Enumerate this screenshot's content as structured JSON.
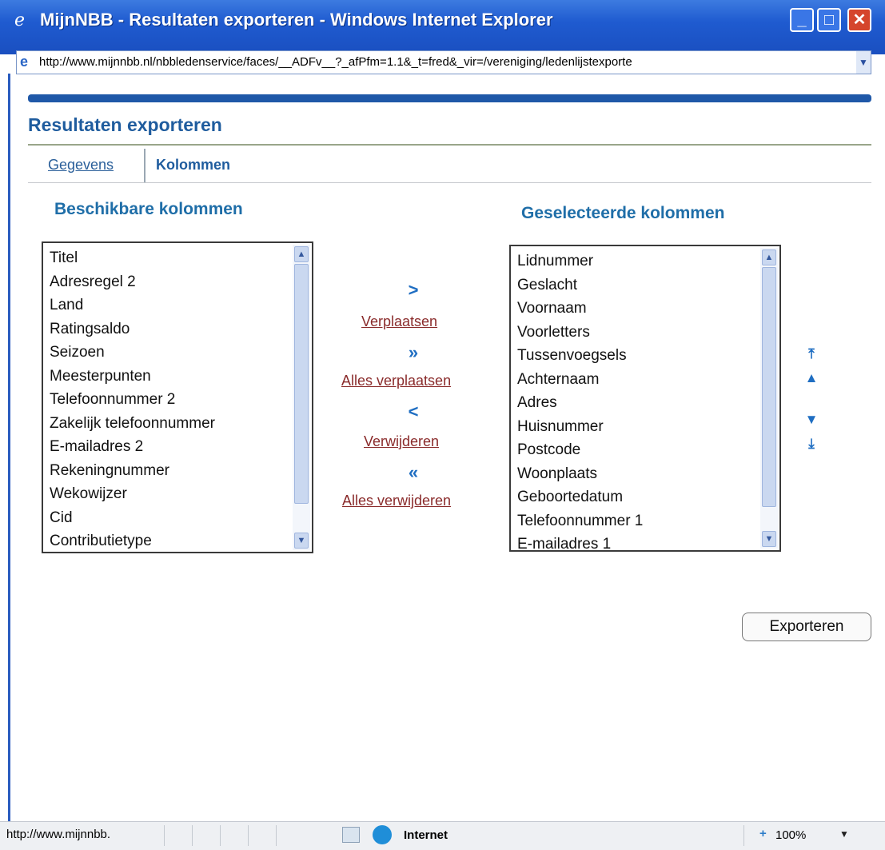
{
  "window": {
    "title": "MijnNBB - Resultaten exporteren - Windows Internet Explorer",
    "address": "http://www.mijnnbb.nl/nbbledenservice/faces/__ADFv__?_afPfm=1.1&_t=fred&_vir=/vereniging/ledenlijstexporte"
  },
  "page": {
    "title": "Resultaten exporteren",
    "tabs": {
      "gegevens": "Gegevens",
      "kolommen": "Kolommen"
    },
    "available_heading": "Beschikbare kolommen",
    "selected_heading": "Geselecteerde kolommen",
    "available_columns": [
      "Titel",
      "Adresregel 2",
      "Land",
      "Ratingsaldo",
      "Seizoen",
      "Meesterpunten",
      "Telefoonnummer 2",
      "Zakelijk telefoonnummer",
      "E-mailadres 2",
      "Rekeningnummer",
      "Wekowijzer",
      "Cid",
      "Contributietype"
    ],
    "selected_columns": [
      "Lidnummer",
      "Geslacht",
      "Voornaam",
      "Voorletters",
      "Tussenvoegsels",
      "Achternaam",
      "Adres",
      "Huisnummer",
      "Postcode",
      "Woonplaats",
      "Geboortedatum",
      "Telefoonnummer 1",
      "E-mailadres 1"
    ],
    "shuttle": {
      "move": "Verplaatsen",
      "move_all": "Alles verplaatsen",
      "remove": "Verwijderen",
      "remove_all": "Alles verwijderen",
      "icons": {
        "move": ">",
        "move_all": "»",
        "remove": "<",
        "remove_all": "«"
      }
    },
    "export_button": "Exporteren"
  },
  "status": {
    "url": "http://www.mijnnbb.",
    "zone": "Internet",
    "zoom": "100%"
  },
  "colors": {
    "titlebar": "#1f5bd0",
    "heading": "#1f6ea8",
    "link": "#8a2b2b"
  }
}
